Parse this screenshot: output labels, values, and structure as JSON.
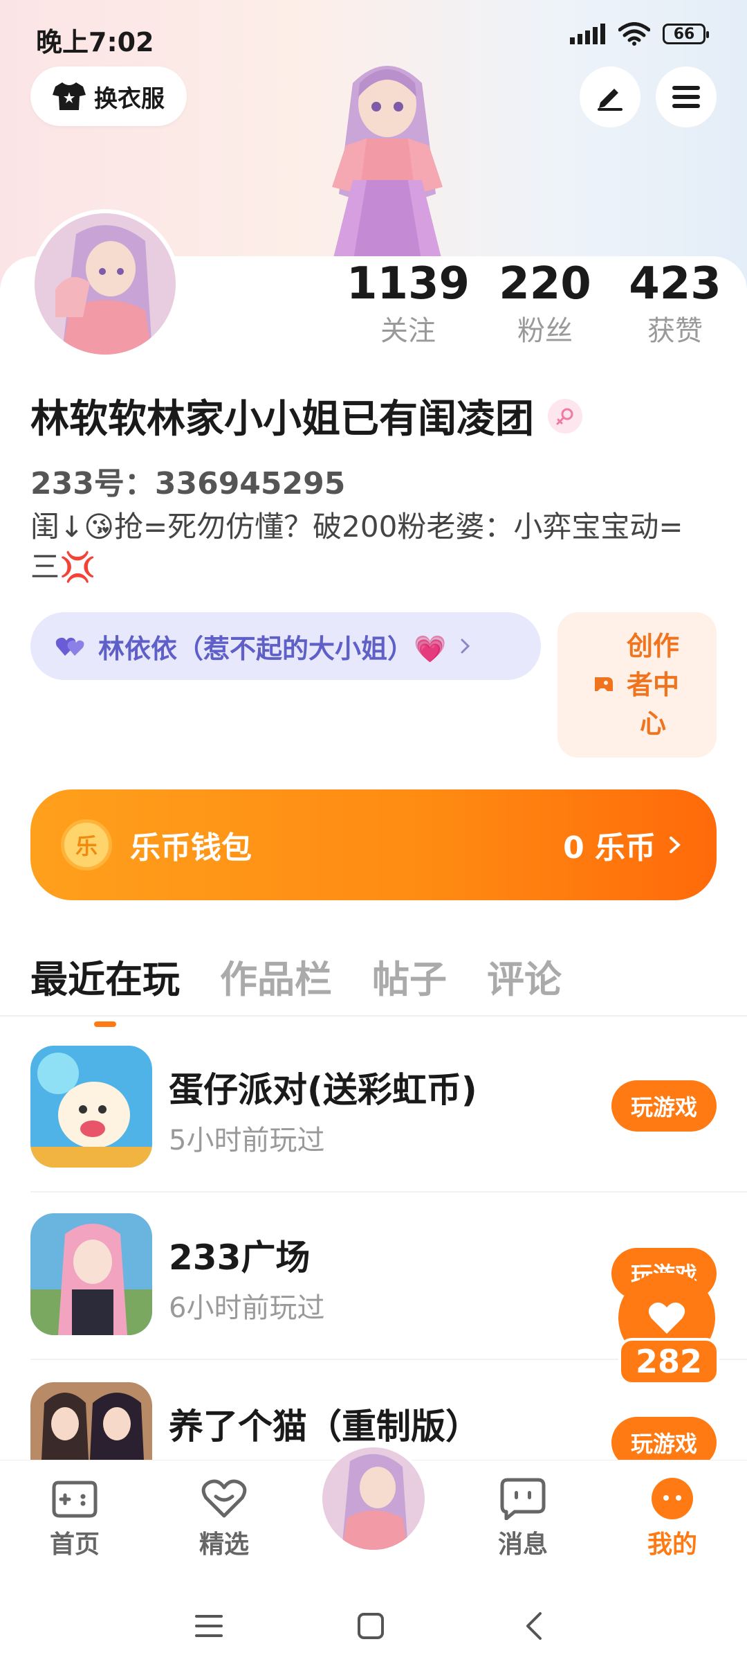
{
  "status_bar": {
    "time": "晚上7:02",
    "battery": "66"
  },
  "header": {
    "outfit_label": "换衣服"
  },
  "profile": {
    "stats": [
      {
        "value": "1139",
        "label": "关注"
      },
      {
        "value": "220",
        "label": "粉丝"
      },
      {
        "value": "423",
        "label": "获赞"
      }
    ],
    "username": "林软软林家小小姐已有闺凌团",
    "uid": "233号：336945295",
    "bio": "闺↓😘抢=死勿仿懂？破200粉老婆：小弈宝宝动=三💢",
    "cp_label": "林依依（惹不起的大小姐）💗",
    "creator_label": "创作者中心"
  },
  "wallet": {
    "title": "乐币钱包",
    "coin_glyph": "乐",
    "amount": "0 乐币"
  },
  "tabs": [
    {
      "label": "最近在玩"
    },
    {
      "label": "作品栏"
    },
    {
      "label": "帖子"
    },
    {
      "label": "评论"
    }
  ],
  "games": [
    {
      "title": "蛋仔派对(送彩虹币)",
      "time": "5小时前玩过",
      "button": "玩游戏"
    },
    {
      "title": "233广场",
      "time": "6小时前玩过",
      "button": "玩游戏"
    },
    {
      "title": "养了个猫（重制版）",
      "time": "",
      "button": "玩游戏"
    }
  ],
  "floating_like": {
    "count": "282"
  },
  "bottom_nav": [
    {
      "label": "首页"
    },
    {
      "label": "精选"
    },
    {
      "label": "消息"
    },
    {
      "label": "我的"
    }
  ],
  "colors": {
    "accent": "#ff7a12",
    "cp_pill": "#e7e8fb",
    "creator_bg": "#fff0e8"
  }
}
